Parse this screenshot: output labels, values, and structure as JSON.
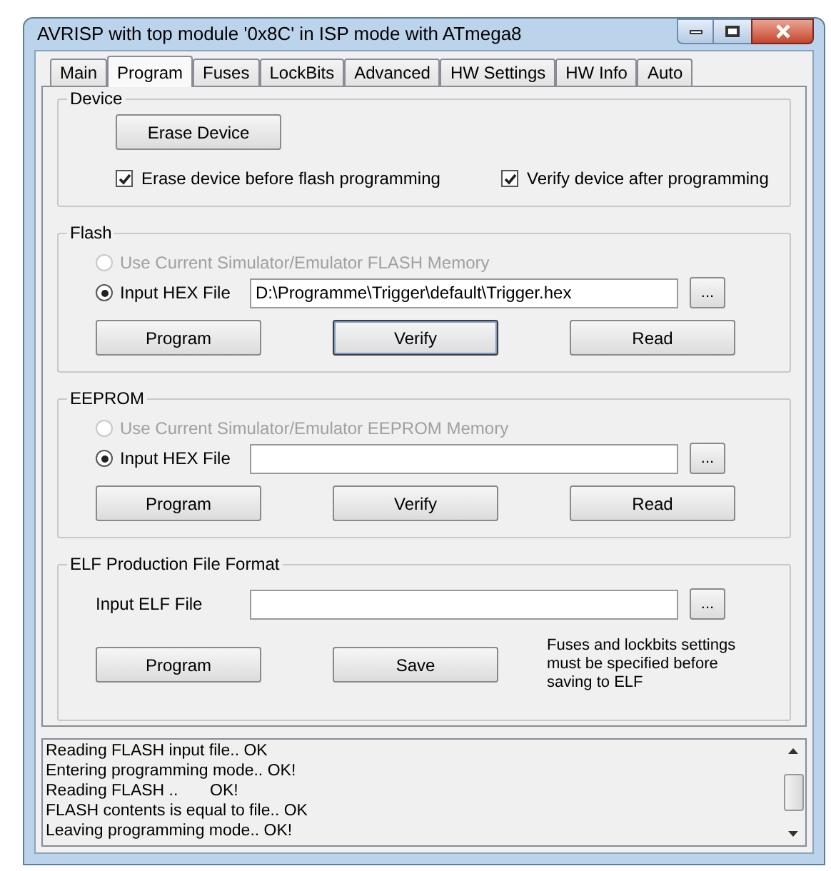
{
  "window": {
    "title": "AVRISP with top module '0x8C' in ISP mode with ATmega8"
  },
  "tabs": [
    {
      "label": "Main",
      "selected": false
    },
    {
      "label": "Program",
      "selected": true
    },
    {
      "label": "Fuses",
      "selected": false
    },
    {
      "label": "LockBits",
      "selected": false
    },
    {
      "label": "Advanced",
      "selected": false
    },
    {
      "label": "HW Settings",
      "selected": false
    },
    {
      "label": "HW Info",
      "selected": false
    },
    {
      "label": "Auto",
      "selected": false
    }
  ],
  "device": {
    "title": "Device",
    "erase_button": "Erase Device",
    "checks": [
      {
        "label": "Erase device before flash programming",
        "checked": true
      },
      {
        "label": "Verify device after programming",
        "checked": true
      }
    ]
  },
  "flash": {
    "title": "Flash",
    "options": [
      {
        "label": "Use Current Simulator/Emulator FLASH Memory",
        "selected": false,
        "disabled": true
      },
      {
        "label": "Input HEX File",
        "selected": true,
        "disabled": false
      }
    ],
    "file_value": "D:\\Programme\\Trigger\\default\\Trigger.hex",
    "browse": "...",
    "buttons": [
      {
        "label": "Program",
        "focused": false
      },
      {
        "label": "Verify",
        "focused": true
      },
      {
        "label": "Read",
        "focused": false
      }
    ]
  },
  "eeprom": {
    "title": "EEPROM",
    "options": [
      {
        "label": "Use Current Simulator/Emulator EEPROM Memory",
        "selected": false,
        "disabled": true
      },
      {
        "label": "Input HEX File",
        "selected": true,
        "disabled": false
      }
    ],
    "browse": "...",
    "buttons": [
      {
        "label": "Program",
        "focused": false
      },
      {
        "label": "Verify",
        "focused": false
      },
      {
        "label": "Read",
        "focused": false
      }
    ]
  },
  "elf": {
    "title": "ELF Production File Format",
    "file_label": "Input ELF File",
    "browse": "...",
    "buttons": [
      {
        "label": "Program",
        "focused": false
      },
      {
        "label": "Save",
        "focused": false
      }
    ],
    "note": "Fuses and lockbits settings must be specified before saving to ELF"
  },
  "log": {
    "lines": [
      "Reading FLASH input file.. OK",
      "Entering programming mode.. OK!",
      "Reading FLASH ..       OK!",
      "FLASH contents is equal to file.. OK",
      "Leaving programming mode.. OK!"
    ]
  }
}
